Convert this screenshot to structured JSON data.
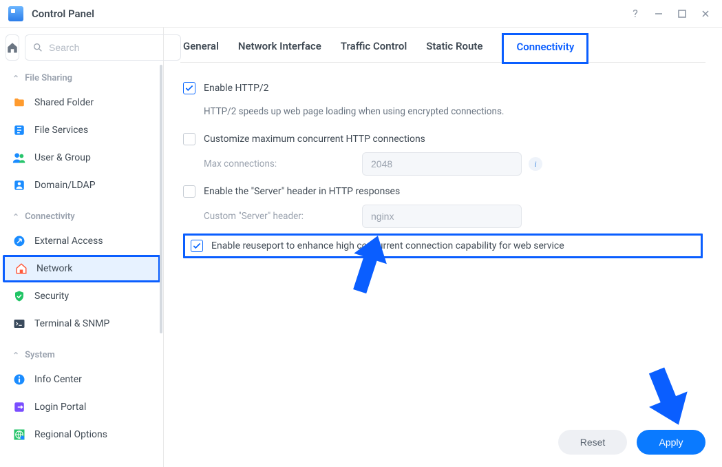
{
  "window": {
    "title": "Control Panel"
  },
  "search": {
    "placeholder": "Search"
  },
  "sections": {
    "file_sharing": "File Sharing",
    "connectivity": "Connectivity",
    "system": "System"
  },
  "sidebar": {
    "shared_folder": "Shared Folder",
    "file_services": "File Services",
    "user_group": "User & Group",
    "domain_ldap": "Domain/LDAP",
    "external_access": "External Access",
    "network": "Network",
    "security": "Security",
    "terminal_snmp": "Terminal & SNMP",
    "info_center": "Info Center",
    "login_portal": "Login Portal",
    "regional_options": "Regional Options"
  },
  "tabs": {
    "general": "General",
    "network_interface": "Network Interface",
    "traffic_control": "Traffic Control",
    "static_route": "Static Route",
    "connectivity": "Connectivity"
  },
  "form": {
    "http2_label": "Enable HTTP/2",
    "http2_desc": "HTTP/2 speeds up web page loading when using encrypted connections.",
    "customize_max_label": "Customize maximum concurrent HTTP connections",
    "max_conn_label": "Max connections:",
    "max_conn_value": "2048",
    "server_header_label": "Enable the \"Server\" header in HTTP responses",
    "custom_header_label": "Custom \"Server\" header:",
    "custom_header_value": "nginx",
    "reuseport_label": "Enable reuseport to enhance high concurrent connection capability for web service"
  },
  "footer": {
    "reset": "Reset",
    "apply": "Apply"
  },
  "info_i": "i"
}
